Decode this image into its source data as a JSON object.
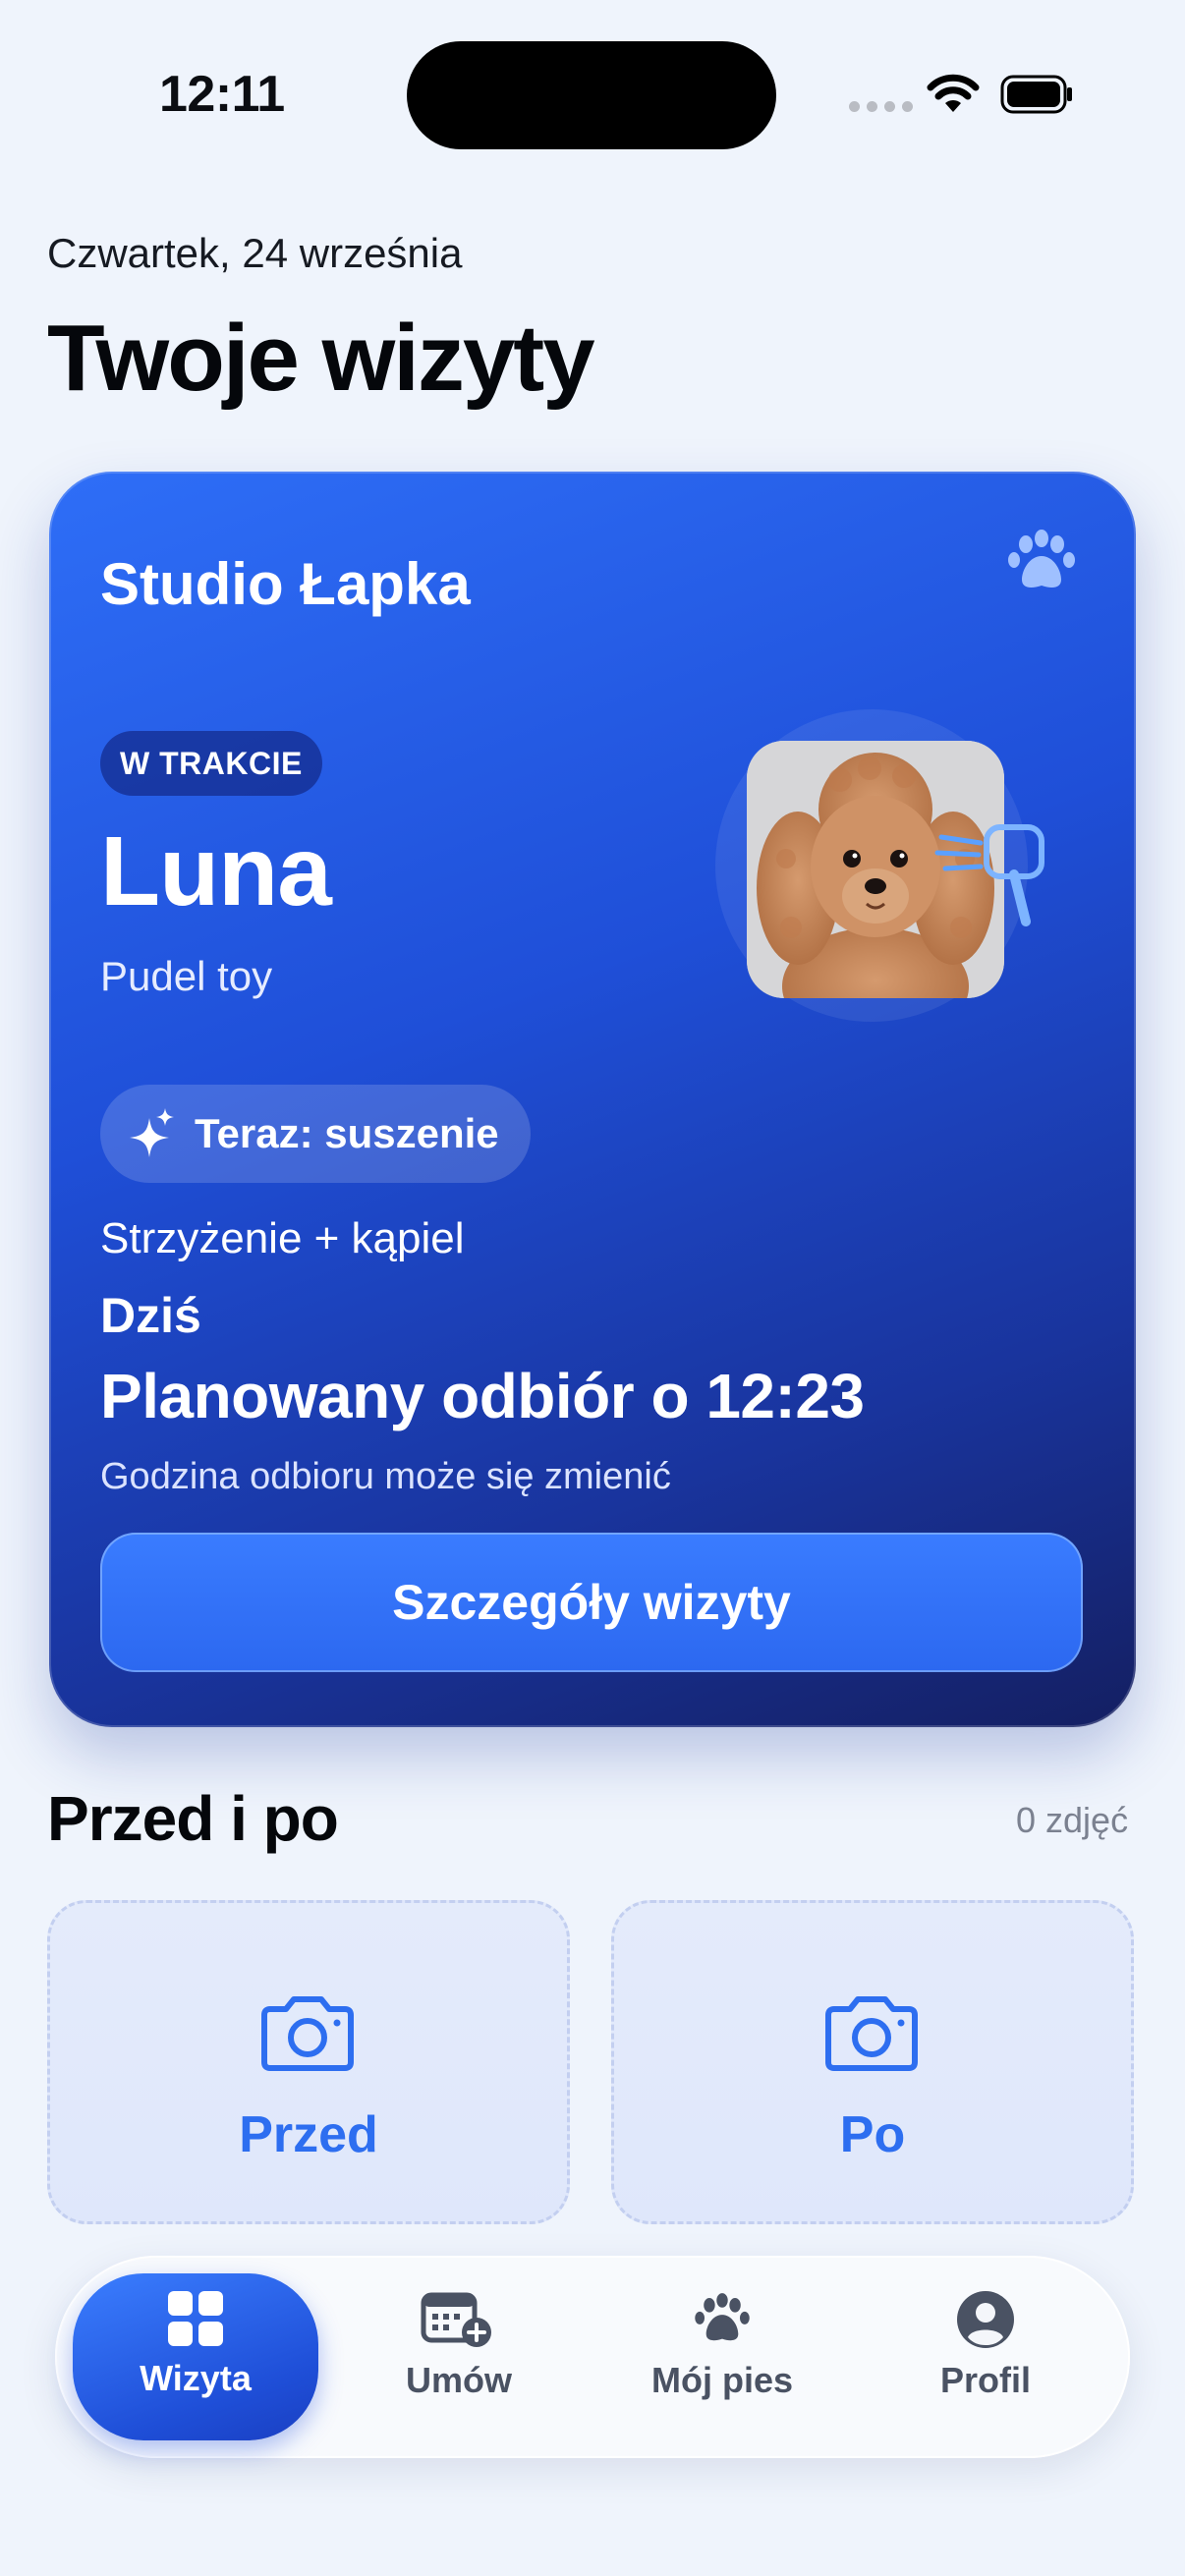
{
  "status_bar": {
    "time": "12:11"
  },
  "header": {
    "date": "Czwartek, 24 września",
    "title": "Twoje wizyty"
  },
  "visit_card": {
    "studio": "Studio Łapka",
    "status_badge": "W TRAKCIE",
    "dog_name": "Luna",
    "breed": "Pudel toy",
    "current_step": "Teraz: suszenie",
    "service": "Strzyżenie + kąpiel",
    "day": "Dziś",
    "pickup": "Planowany odbiór o 12:23",
    "pickup_note": "Godzina odbioru może się zmienić",
    "details_button": "Szczegóły wizyty",
    "colors": {
      "accent": "#2e6ef7",
      "deep": "#141f62"
    }
  },
  "before_after": {
    "title": "Przed i po",
    "count": "0 zdjęć",
    "slots": [
      {
        "label": "Przed",
        "icon": "camera-icon"
      },
      {
        "label": "Po",
        "icon": "camera-icon"
      }
    ]
  },
  "tab_bar": {
    "active": "Wizyta",
    "tabs": [
      {
        "label": "Wizyta",
        "icon": "grid-icon"
      },
      {
        "label": "Umów",
        "icon": "calendar-add-icon"
      },
      {
        "label": "Mój pies",
        "icon": "paw-icon"
      },
      {
        "label": "Profil",
        "icon": "profile-icon"
      }
    ]
  }
}
